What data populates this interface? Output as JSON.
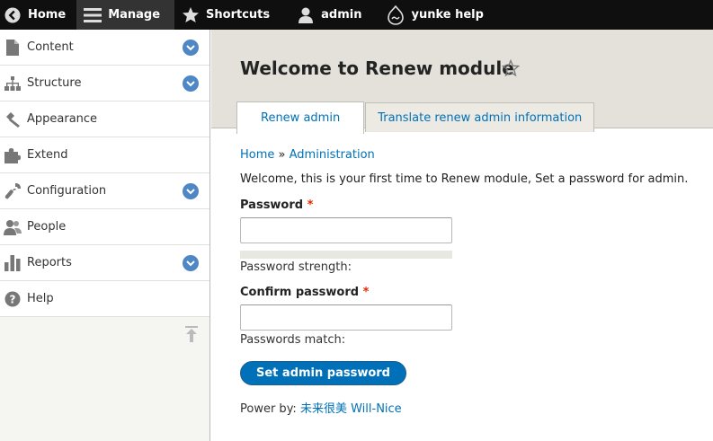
{
  "toolbar": {
    "home": "Home",
    "manage": "Manage",
    "shortcuts": "Shortcuts",
    "admin": "admin",
    "site": "yunke help"
  },
  "sidebar": {
    "items": [
      {
        "label": "Content",
        "icon": "file-icon",
        "expandable": true
      },
      {
        "label": "Structure",
        "icon": "sitemap-icon",
        "expandable": true
      },
      {
        "label": "Appearance",
        "icon": "paintbrush-icon",
        "expandable": false
      },
      {
        "label": "Extend",
        "icon": "puzzle-icon",
        "expandable": false
      },
      {
        "label": "Configuration",
        "icon": "wrench-icon",
        "expandable": true
      },
      {
        "label": "People",
        "icon": "people-icon",
        "expandable": false
      },
      {
        "label": "Reports",
        "icon": "bar-chart-icon",
        "expandable": true
      },
      {
        "label": "Help",
        "icon": "help-icon",
        "expandable": false
      }
    ]
  },
  "page": {
    "title": "Welcome to Renew module",
    "tabs": [
      {
        "label": "Renew admin",
        "active": true
      },
      {
        "label": "Translate renew admin information",
        "active": false
      }
    ]
  },
  "breadcrumb": {
    "home": "Home",
    "sep": "»",
    "admin": "Administration"
  },
  "form": {
    "intro": "Welcome, this is your first time to Renew module, Set a password for admin.",
    "password_label": "Password",
    "password_value": "",
    "required_mark": "*",
    "strength_label": "Password strength:",
    "confirm_label": "Confirm password",
    "confirm_value": "",
    "match_label": "Passwords match:",
    "submit_label": "Set admin password"
  },
  "footer": {
    "power_prefix": "Power by:",
    "power_link": "未来很美 Will-Nice"
  },
  "colors": {
    "accent": "#0071b8",
    "toolbar_bg": "#0f0f0f",
    "chevron_bg": "#4f86c6",
    "required": "#e32700"
  }
}
